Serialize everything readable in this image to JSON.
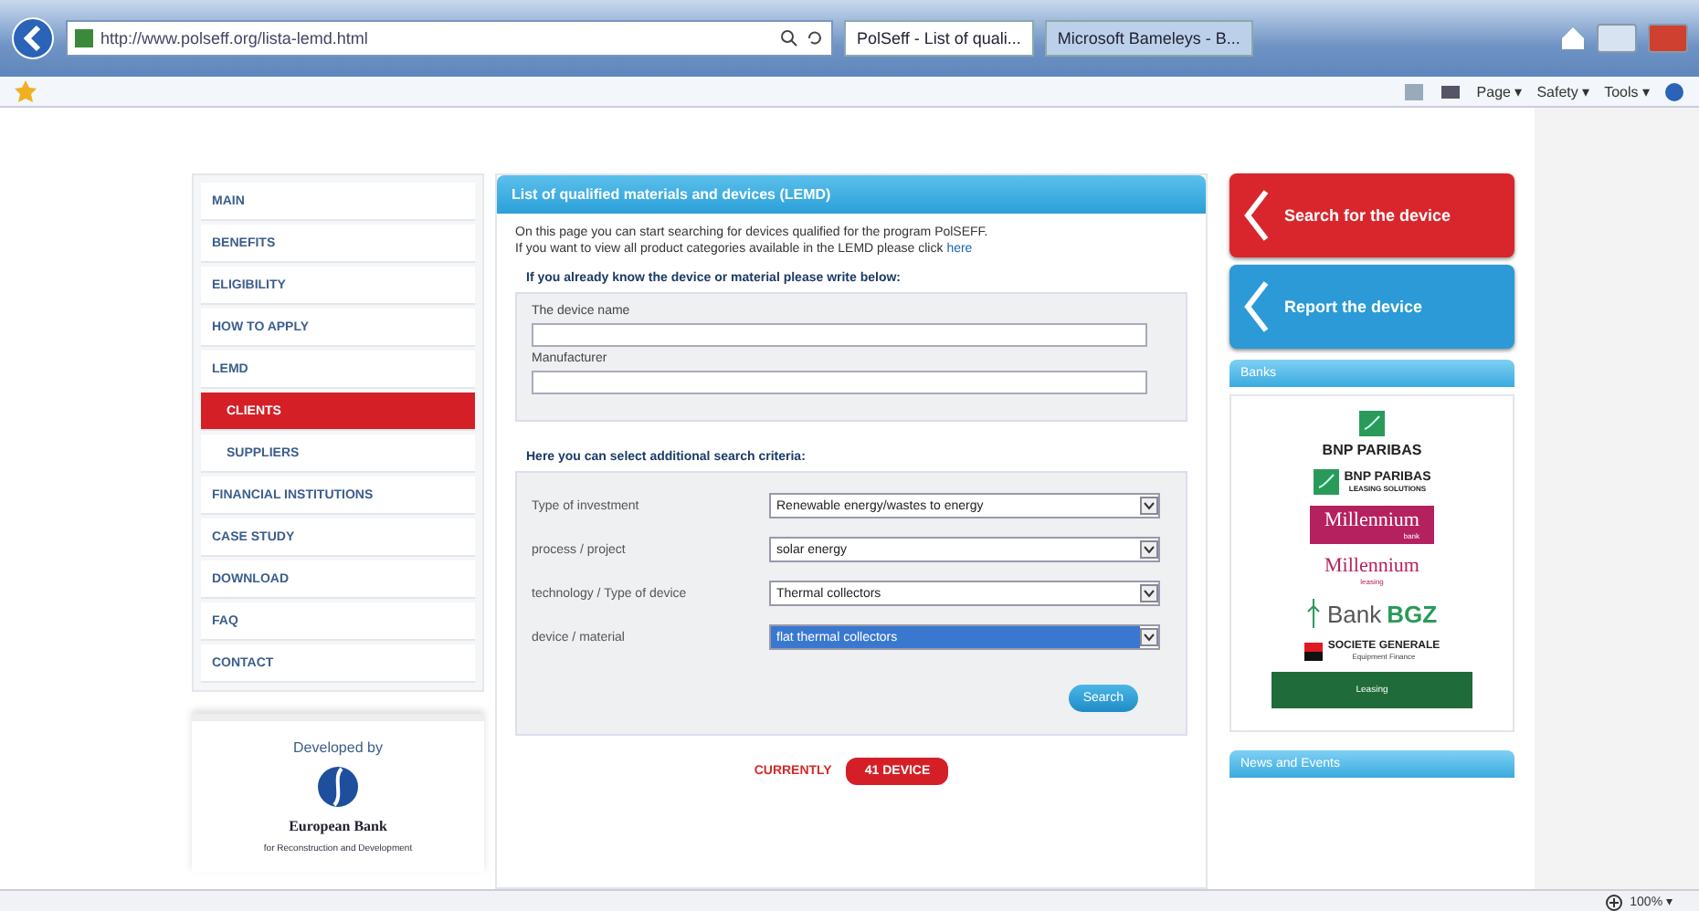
{
  "browser": {
    "address": "http://www.polseff.org/lista-lemd.html",
    "tabs": [
      {
        "label": "PolSeff - List of quali...",
        "selected": true
      },
      {
        "label": "Microsoft Bameleys - B...",
        "selected": false
      }
    ],
    "commands": [
      "Page ▾",
      "Safety ▾",
      "Tools ▾"
    ],
    "zoom": "100% ▾"
  },
  "nav": [
    {
      "label": "MAIN",
      "kind": "main",
      "selected": false
    },
    {
      "label": "BENEFITS",
      "kind": "main",
      "selected": false
    },
    {
      "label": "ELIGIBILITY",
      "kind": "main",
      "selected": false
    },
    {
      "label": "HOW TO APPLY",
      "kind": "main",
      "selected": false
    },
    {
      "label": "LEMD",
      "kind": "main",
      "selected": false
    },
    {
      "label": "CLIENTS",
      "kind": "sub",
      "selected": true
    },
    {
      "label": "SUPPLIERS",
      "kind": "sub",
      "selected": false
    },
    {
      "label": "FINANCIAL INSTITUTIONS",
      "kind": "main",
      "selected": false
    },
    {
      "label": "CASE STUDY",
      "kind": "main",
      "selected": false
    },
    {
      "label": "DOWNLOAD",
      "kind": "main",
      "selected": false
    },
    {
      "label": "FAQ",
      "kind": "main",
      "selected": false
    },
    {
      "label": "CONTACT",
      "kind": "main",
      "selected": false
    }
  ],
  "developer": {
    "caption": "Developed by",
    "bank_name": "European Bank",
    "bank_subtitle": "for Reconstruction and Development"
  },
  "lemd": {
    "title": "List of qualified materials and devices (LEMD)",
    "intro": "On this page you can start searching for devices qualified for the program PolSEFF.",
    "intro_link_prefix": "If you want to view all product categories available in the LEMD please click ",
    "intro_link": "here",
    "name_heading": "If you already know the device or material please write below:",
    "fields": [
      {
        "label": "The device name"
      },
      {
        "label": "Manufacturer"
      }
    ],
    "criteria_heading": "Here you can select additional search criteria:",
    "criteria": [
      {
        "label": "Type of investment",
        "value": "Renewable energy/wastes to energy",
        "focused": false
      },
      {
        "label": "process / project",
        "value": "solar energy",
        "focused": false
      },
      {
        "label": "technology / Type of device",
        "value": "Thermal collectors",
        "focused": false
      },
      {
        "label": "device / material",
        "value": "flat thermal collectors",
        "focused": true
      }
    ],
    "search_button": "Search",
    "counter_caption": "CURRENTLY",
    "counter_value": "41 DEVICE"
  },
  "actions": [
    {
      "label": "Search for the device",
      "color": "#d9262c"
    },
    {
      "label": "Report the device",
      "color": "#2b9ad6"
    }
  ],
  "banks": {
    "title": "Banks",
    "logos": [
      {
        "kind": "bnp",
        "text": "BNP PARIBAS"
      },
      {
        "kind": "bnp-inline",
        "text": "BNP PARIBAS",
        "subtext": "LEASING SOLUTIONS"
      },
      {
        "kind": "millennium-block",
        "text": "Millennium",
        "subtext": "bank"
      },
      {
        "kind": "millennium-text",
        "text": "Millennium",
        "subtext": "leasing"
      },
      {
        "kind": "bgz",
        "text": "Bank",
        "subtext": "BGZ"
      },
      {
        "kind": "socgen",
        "text": "SOCIETE GENERALE",
        "subtext": "Equipment Finance"
      },
      {
        "kind": "green-block",
        "text": "Leasing"
      }
    ]
  },
  "news": {
    "title": "News and Events"
  }
}
